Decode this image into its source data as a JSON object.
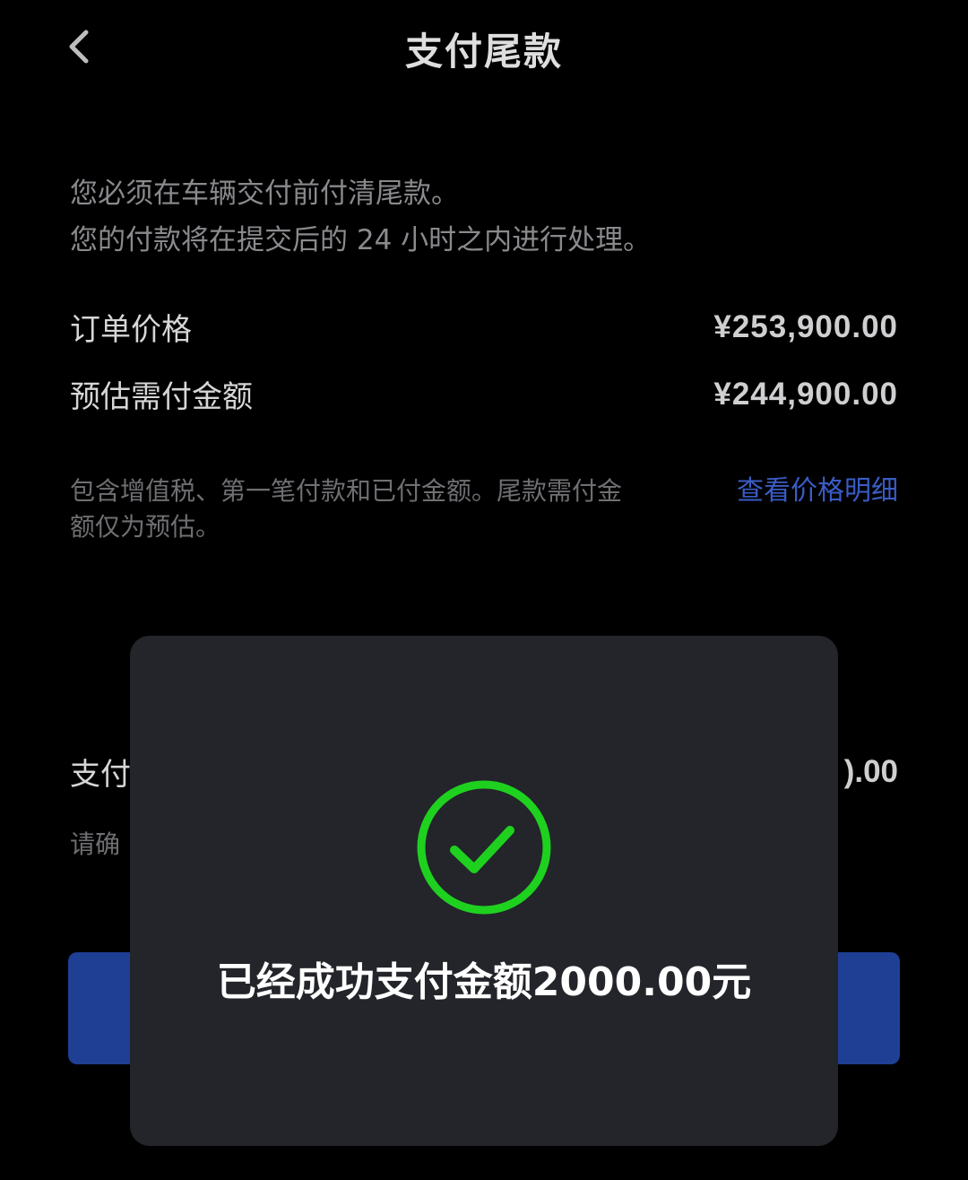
{
  "header": {
    "title": "支付尾款",
    "back_icon": "chevron-left-icon"
  },
  "intro": {
    "line1": "您必须在车辆交付前付清尾款。",
    "line2": "您的付款将在提交后的 24 小时之内进行处理。"
  },
  "prices": {
    "order_label": "订单价格",
    "order_value": "¥253,900.00",
    "estimate_label": "预估需付金额",
    "estimate_value": "¥244,900.00"
  },
  "note": {
    "text": "包含增值税、第一笔付款和已付金额。尾款需付金额仅为预估。",
    "link": "查看价格明细"
  },
  "payment": {
    "label_partial": "支付",
    "value_partial": ").00",
    "confirm_partial": "请确"
  },
  "toast": {
    "message": "已经成功支付金额2000.00元",
    "icon": "check-circle-icon",
    "icon_color": "#1fd11f"
  },
  "colors": {
    "background": "#000000",
    "toast_bg": "#23252a",
    "link": "#3a5cc4",
    "button": "#1f3f94"
  }
}
